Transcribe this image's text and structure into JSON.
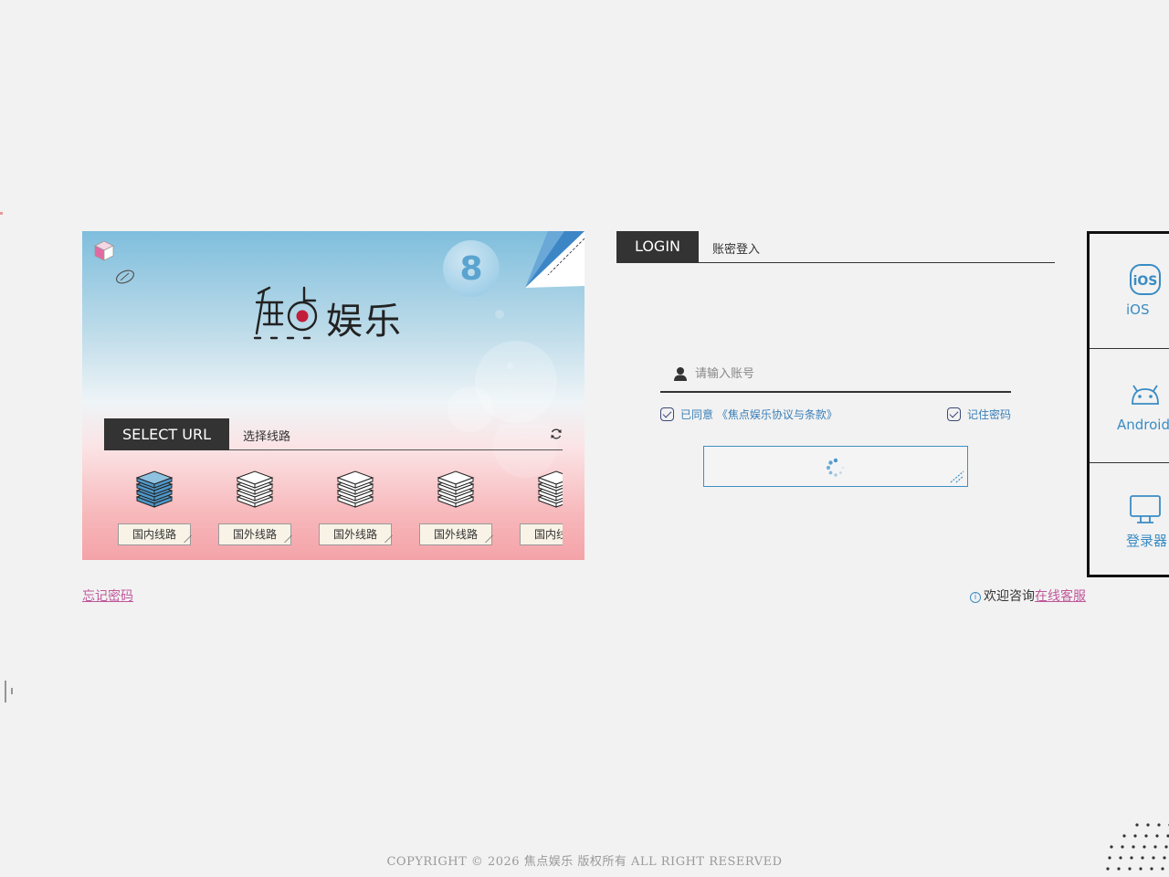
{
  "banner": {
    "brand_name": "娱乐",
    "select_url_label": "SELECT URL",
    "select_url_desc": "选择线路",
    "lines": [
      {
        "label": "国内线路",
        "active": true
      },
      {
        "label": "国外线路",
        "active": false
      },
      {
        "label": "国外线路",
        "active": false
      },
      {
        "label": "国外线路",
        "active": false
      },
      {
        "label": "国内线路",
        "active": false
      }
    ],
    "ball_number": "8"
  },
  "login": {
    "tab_label": "LOGIN",
    "tab_desc": "账密登入",
    "account_placeholder": "请输入账号",
    "agree_label": "已同意 《焦点娱乐协议与条款》",
    "remember_label": "记住密码"
  },
  "apps": [
    {
      "label": "iOS",
      "icon": "ios-icon",
      "badge": "iOS"
    },
    {
      "label": "Android",
      "icon": "android-icon"
    },
    {
      "label": "登录器",
      "icon": "monitor-icon"
    }
  ],
  "footer": {
    "forgot_password": "忘记密码",
    "consult_text": "欢迎咨询",
    "service_link": "在线客服",
    "info_glyph": "i",
    "copyright": "COPYRIGHT © 2026 焦点娱乐 版权所有 ALL RIGHT RESERVED"
  },
  "colors": {
    "accent_blue": "#3a8cc4",
    "link_pink": "#c0589a",
    "dark_tab": "#333333"
  }
}
